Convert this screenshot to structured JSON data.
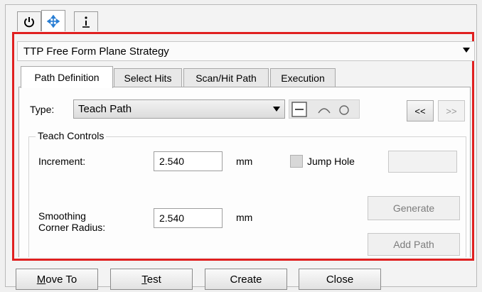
{
  "top_tabs": [
    {
      "icon": "power-icon",
      "selected": false
    },
    {
      "icon": "move-arrows-icon",
      "selected": true
    },
    {
      "icon": "info-icon",
      "selected": false
    }
  ],
  "strategy": {
    "value": "TTP Free Form Plane Strategy"
  },
  "tabs": [
    {
      "label": "Path Definition",
      "selected": true
    },
    {
      "label": "Select Hits",
      "selected": false
    },
    {
      "label": "Scan/Hit Path",
      "selected": false
    },
    {
      "label": "Execution",
      "selected": false
    }
  ],
  "type_row": {
    "label": "Type:",
    "value": "Teach Path",
    "shape_icons": [
      "line-segment-icon",
      "arc-icon",
      "circle-icon"
    ],
    "prev_label": "<<",
    "next_label": ">>"
  },
  "teach_controls": {
    "title": "Teach Controls",
    "increment_label": "Increment:",
    "increment_value": "2.540",
    "increment_unit": "mm",
    "jump_hole_label": "Jump Hole",
    "jump_hole_checked": false,
    "smoothing_label_line1": "Smoothing",
    "smoothing_label_line2": "Corner Radius:",
    "smoothing_value": "2.540",
    "smoothing_unit": "mm",
    "generate_label": "Generate",
    "add_path_label": "Add Path"
  },
  "bottom_buttons": {
    "move_to_first": "M",
    "move_to_rest": "ove To",
    "test_first": "T",
    "test_rest": "est",
    "create": "Create",
    "close": "Close"
  },
  "colors": {
    "highlight_border": "#e02020",
    "icon_blue": "#2a7fd4"
  }
}
